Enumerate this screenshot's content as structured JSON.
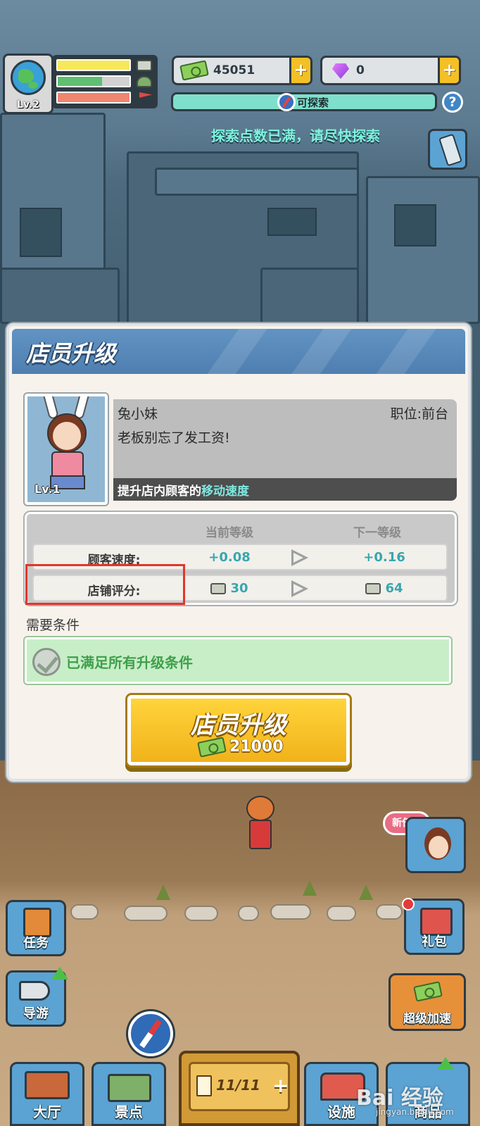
{
  "hud": {
    "player_level": "Lv.2",
    "money": "45051",
    "gems": "0",
    "explore_label": "可探索",
    "help_symbol": "?",
    "notice": "探索点数已满，请尽快探索",
    "plus_symbol": "+"
  },
  "modal": {
    "title": "店员升级",
    "staff": {
      "name": "兔小妹",
      "position": "职位:前台",
      "quote": "老板别忘了发工资!",
      "level": "Lv.1",
      "effect_prefix": "提升店内顾客的",
      "effect_highlight": "移动速度"
    },
    "stats": {
      "current_header": "当前等级",
      "next_header": "下一等级",
      "rows": [
        {
          "label": "顾客速度:",
          "current": "+0.08",
          "next": "+0.16"
        },
        {
          "label": "店铺评分:",
          "current": "30",
          "next": "64"
        }
      ]
    },
    "requirements": {
      "title": "需要条件",
      "status": "已满足所有升级条件"
    },
    "upgrade_button": {
      "label": "店员升级",
      "cost": "21000"
    }
  },
  "side_buttons": {
    "new_task": "新任务",
    "tasks": "任务",
    "gift": "礼包",
    "guide": "导游",
    "super_speed": "超级加速"
  },
  "bottom_nav": {
    "hall": "大厅",
    "spots": "景点",
    "counter": "11/11",
    "facilities": "设施",
    "shop_partial": "商品"
  },
  "watermark": {
    "main": "Bai 经验",
    "sub": "jingyan.baidu.com"
  },
  "colors": {
    "accent_teal": "#7ee0cc",
    "header_blue": "#5b8cbd",
    "button_yellow": "#f3c026",
    "highlight_red": "#e2362b",
    "stat_value": "#38a6b0"
  },
  "icons": [
    "globe-icon",
    "shop-icon",
    "flag-icon",
    "money-icon",
    "gem-icon",
    "compass-icon",
    "help-icon",
    "phone-icon",
    "check-icon",
    "arrow-right-icon",
    "book-icon",
    "gift-icon",
    "megaphone-icon",
    "speed-money-icon",
    "map-icon"
  ]
}
